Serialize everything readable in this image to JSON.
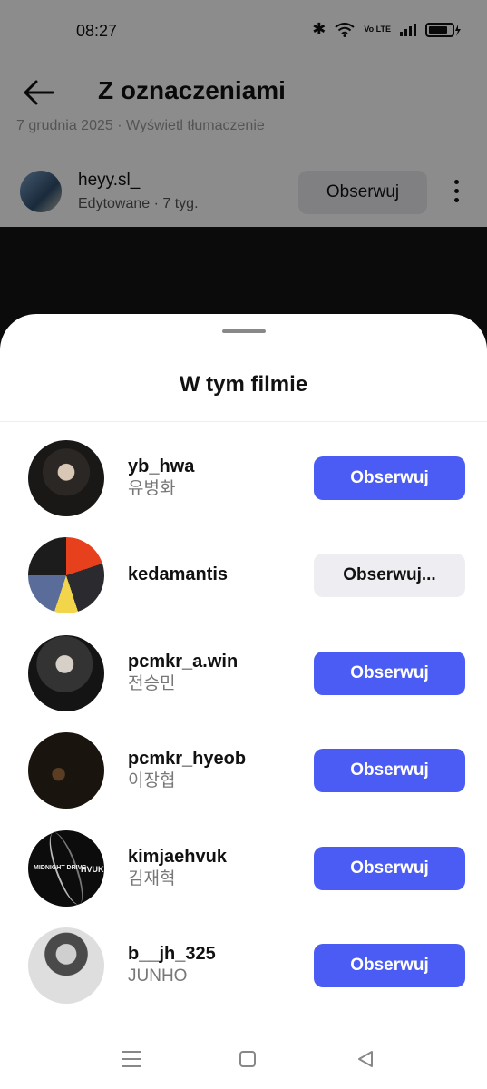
{
  "status_bar": {
    "time": "08:27",
    "network_label": "Vo LTE"
  },
  "header": {
    "title": "Z oznaczeniami"
  },
  "faded_text": "7 grudnia 2025 · Wyświetl tłumaczenie",
  "post": {
    "author": "heyy.sl_",
    "meta": "Edytowane · 7 tyg.",
    "follow_label": "Obserwuj"
  },
  "sheet": {
    "title": "W tym filmie",
    "users": [
      {
        "handle": "yb_hwa",
        "name": "유병화",
        "button": "Obserwuj",
        "button_style": "primary"
      },
      {
        "handle": "kedamantis",
        "name": "",
        "button": "Obserwuj...",
        "button_style": "secondary"
      },
      {
        "handle": "pcmkr_a.win",
        "name": "전승민",
        "button": "Obserwuj",
        "button_style": "primary"
      },
      {
        "handle": "pcmkr_hyeob",
        "name": "이장협",
        "button": "Obserwuj",
        "button_style": "primary"
      },
      {
        "handle": "kimjaehvuk",
        "name": "김재혁",
        "button": "Obserwuj",
        "button_style": "primary"
      },
      {
        "handle": "b__jh_325",
        "name": "JUNHO",
        "button": "Obserwuj",
        "button_style": "primary"
      }
    ],
    "avatar5_text_left": "MIDNIGHT DRIVE",
    "avatar5_text_right": "HVUK"
  },
  "colors": {
    "primary_button": "#4b5cf5",
    "secondary_button": "#eeeef2"
  }
}
